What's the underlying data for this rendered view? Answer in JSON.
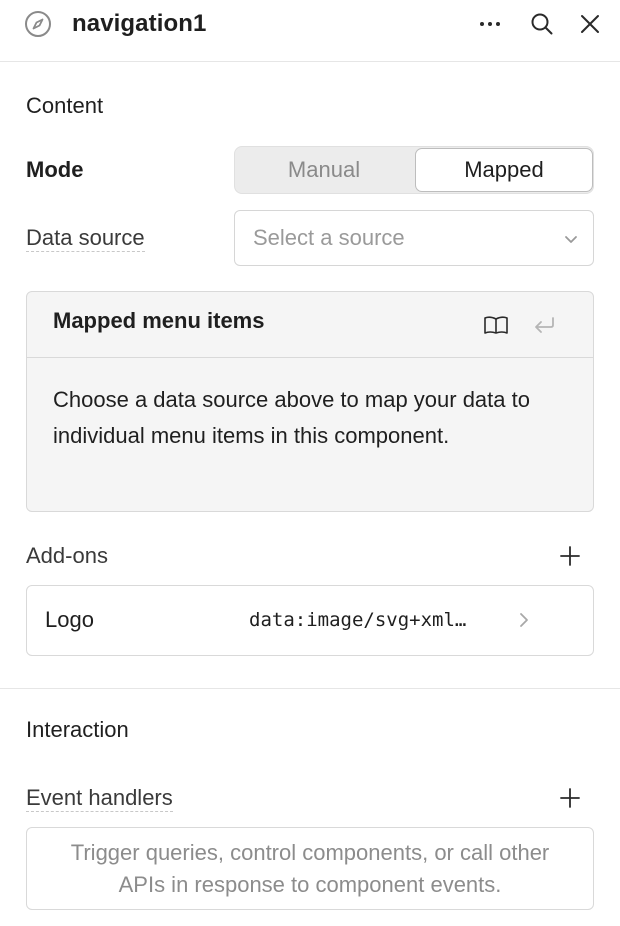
{
  "header": {
    "title": "navigation1",
    "icon": "compass-icon"
  },
  "content": {
    "section_title": "Content",
    "mode": {
      "label": "Mode",
      "options": [
        "Manual",
        "Mapped"
      ],
      "selected": "Mapped"
    },
    "data_source": {
      "label": "Data source",
      "placeholder": "Select a source"
    },
    "mapped_menu_items": {
      "title": "Mapped menu items",
      "description": "Choose a data source above to map your data to individual menu items in this component."
    },
    "addons": {
      "label": "Add-ons",
      "items": [
        {
          "name": "Logo",
          "value": "data:image/svg+xml…"
        }
      ]
    }
  },
  "interaction": {
    "section_title": "Interaction",
    "event_handlers": {
      "label": "Event handlers",
      "empty_text": "Trigger queries, control components, or call other APIs in response to component events."
    }
  },
  "colors": {
    "text": "#1f1f1f",
    "muted": "#8c8c8c",
    "border": "#d9d9d9",
    "panel_bg": "#f5f5f5"
  }
}
